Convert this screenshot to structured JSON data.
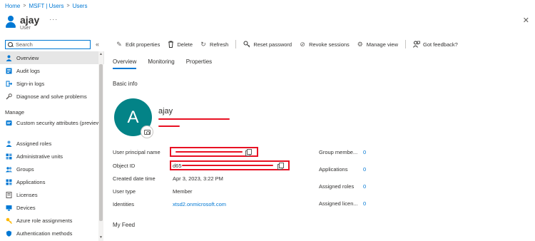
{
  "breadcrumb": [
    "Home",
    "MSFT | Users",
    "Users"
  ],
  "header": {
    "title": "ajay",
    "subtitle": "User",
    "more": "···"
  },
  "search": {
    "placeholder": "Search"
  },
  "sidebar": {
    "items": [
      {
        "label": "Overview",
        "icon": "person-icon",
        "selected": true
      },
      {
        "label": "Audit logs",
        "icon": "audit-log-icon"
      },
      {
        "label": "Sign-in logs",
        "icon": "sign-in-icon"
      },
      {
        "label": "Diagnose and solve problems",
        "icon": "wrench-icon"
      }
    ],
    "manage_heading": "Manage",
    "manage_items": [
      {
        "label": "Custom security attributes (preview)",
        "icon": "security-attributes-icon"
      },
      {
        "label": "Assigned roles",
        "icon": "roles-icon"
      },
      {
        "label": "Administrative units",
        "icon": "admin-units-icon"
      },
      {
        "label": "Groups",
        "icon": "groups-icon"
      },
      {
        "label": "Applications",
        "icon": "applications-icon"
      },
      {
        "label": "Licenses",
        "icon": "licenses-icon"
      },
      {
        "label": "Devices",
        "icon": "devices-icon"
      },
      {
        "label": "Azure role assignments",
        "icon": "key-icon"
      },
      {
        "label": "Authentication methods",
        "icon": "shield-icon"
      }
    ]
  },
  "toolbar": {
    "edit": "Edit properties",
    "delete": "Delete",
    "refresh": "Refresh",
    "reset_password": "Reset password",
    "revoke": "Revoke sessions",
    "manage_view": "Manage view",
    "feedback": "Got feedback?"
  },
  "tabs": [
    "Overview",
    "Monitoring",
    "Properties"
  ],
  "basic_info": {
    "title": "Basic info",
    "avatar_letter": "A",
    "name": "ajay"
  },
  "properties": {
    "upn_label": "User principal name",
    "object_id_label": "Object ID",
    "object_id_prefix": "d65",
    "created_label": "Created date time",
    "created_value": "Apr 3, 2023, 3:22 PM",
    "user_type_label": "User type",
    "user_type_value": "Member",
    "identities_label": "Identities",
    "identities_value": "xtsd2.onmicrosoft.com"
  },
  "stats": [
    {
      "label": "Group membe...",
      "value": "0"
    },
    {
      "label": "Applications",
      "value": "0"
    },
    {
      "label": "Assigned roles",
      "value": "0"
    },
    {
      "label": "Assigned licen...",
      "value": "0"
    }
  ],
  "feed_title": "My Feed",
  "colors": {
    "accent": "#0078d4",
    "avatar": "#038387",
    "redaction": "#e81123"
  }
}
